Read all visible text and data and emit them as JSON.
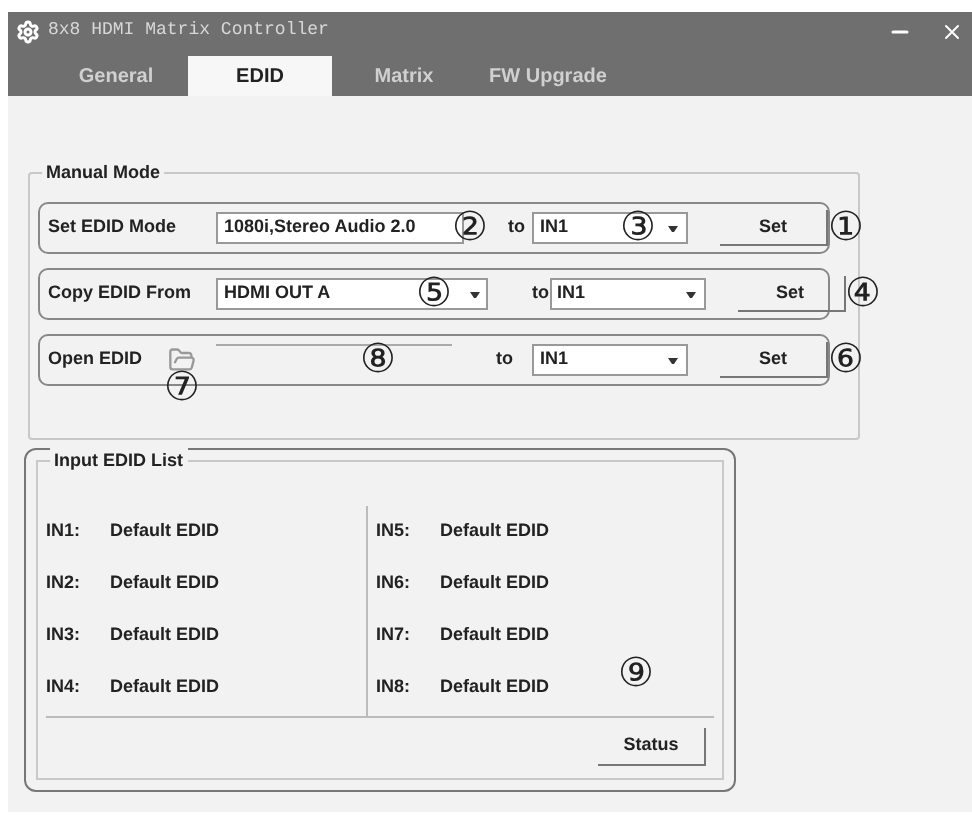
{
  "window": {
    "title": "8x8 HDMI Matrix Controller"
  },
  "tabs": [
    {
      "label": "General",
      "selected": false
    },
    {
      "label": "EDID",
      "selected": true
    },
    {
      "label": "Matrix",
      "selected": false
    },
    {
      "label": "FW Upgrade",
      "selected": false
    }
  ],
  "manual_mode": {
    "title": "Manual Mode",
    "rows": [
      {
        "kind": "text",
        "label": "Set EDID Mode",
        "source": "1080i,Stereo Audio 2.0",
        "source_callout": "②",
        "to": "to",
        "target": "IN1",
        "target_callout": "③",
        "button": "Set",
        "button_callout": "①"
      },
      {
        "kind": "dropdown",
        "label": "Copy EDID From",
        "source": "HDMI OUT A",
        "source_callout": "⑤",
        "to": "to",
        "target": "IN1",
        "button": "Set",
        "button_callout": "④"
      },
      {
        "kind": "file",
        "label": "Open EDID",
        "icon_callout": "⑦",
        "source_callout": "⑧",
        "to": "to",
        "target": "IN1",
        "button": "Set",
        "button_callout": "⑥"
      }
    ]
  },
  "input_edid_list": {
    "title": "Input EDID List",
    "columns": [
      [
        {
          "port": "IN1:",
          "edid": "Default EDID"
        },
        {
          "port": "IN2:",
          "edid": "Default EDID"
        },
        {
          "port": "IN3:",
          "edid": "Default EDID"
        },
        {
          "port": "IN4:",
          "edid": "Default EDID"
        }
      ],
      [
        {
          "port": "IN5:",
          "edid": "Default EDID"
        },
        {
          "port": "IN6:",
          "edid": "Default EDID"
        },
        {
          "port": "IN7:",
          "edid": "Default EDID"
        },
        {
          "port": "IN8:",
          "edid": "Default EDID"
        }
      ]
    ],
    "callout": "⑨",
    "button": "Status"
  }
}
